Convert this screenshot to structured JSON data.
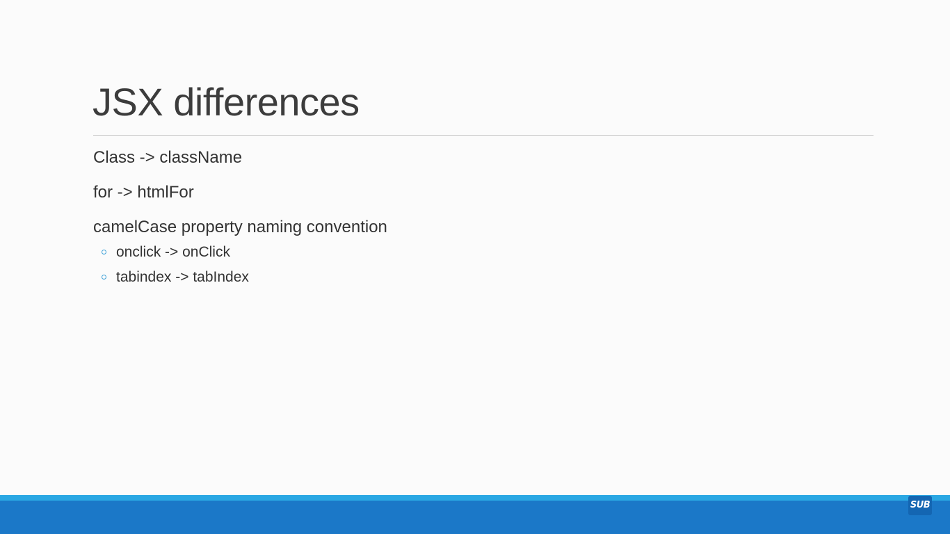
{
  "slide": {
    "title": "JSX differences",
    "bullets": [
      {
        "text": "Class -> className"
      },
      {
        "text": "for -> htmlFor"
      },
      {
        "text": "camelCase property naming convention",
        "subbullets": [
          {
            "text": "onclick -> onClick"
          },
          {
            "text": "tabindex -> tabIndex"
          }
        ]
      }
    ]
  },
  "footer": {
    "logo_text": "SUB",
    "stripe_color": "#2aa7e3",
    "bar_color": "#1b78c8"
  }
}
